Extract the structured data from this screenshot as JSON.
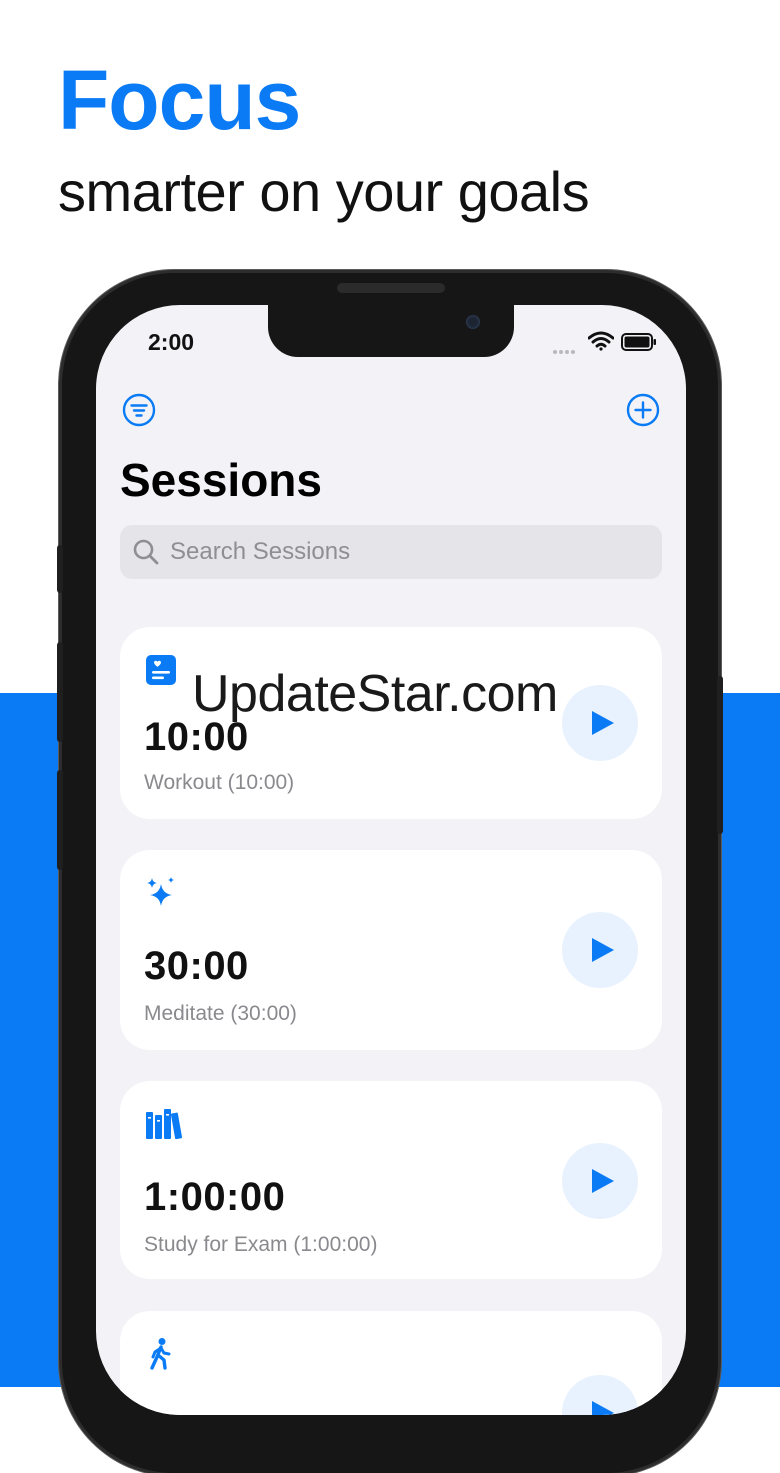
{
  "promo": {
    "headline": "Focus",
    "subheadline": "smarter on your goals"
  },
  "colors": {
    "accent": "#0a7bf5",
    "background_band": "#0a7bf5",
    "screen_bg": "#f2f2f7",
    "card_bg": "#ffffff",
    "play_bg": "#e8f2fe"
  },
  "status_bar": {
    "time": "2:00"
  },
  "toolbar": {
    "filter_icon": "filter-icon",
    "add_icon": "plus-icon"
  },
  "page": {
    "title": "Sessions"
  },
  "search": {
    "placeholder": "Search Sessions",
    "value": ""
  },
  "sessions": [
    {
      "icon": "heart-document-icon",
      "duration": "10:00",
      "caption": "Workout (10:00)"
    },
    {
      "icon": "sparkles-icon",
      "duration": "30:00",
      "caption": "Meditate (30:00)"
    },
    {
      "icon": "books-icon",
      "duration": "1:00:00",
      "caption": "Study for Exam (1:00:00)"
    },
    {
      "icon": "walking-person-icon"
    }
  ],
  "watermark": "UpdateStar.com"
}
